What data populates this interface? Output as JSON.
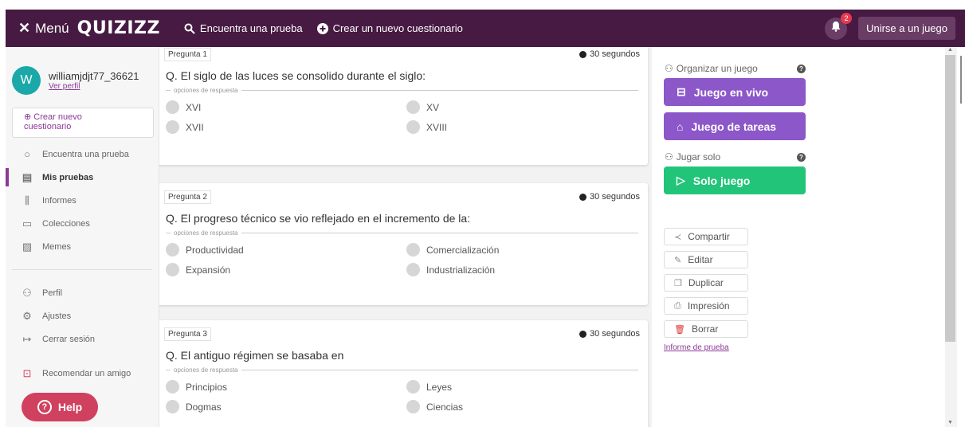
{
  "topbar": {
    "menu_label": "Menú",
    "logo_text": "QUIZIZZ",
    "search_label": "Encuentra una prueba",
    "create_label": "Crear un nuevo cuestionario",
    "notifications_count": "2",
    "join_label": "Unirse a un juego"
  },
  "sidebar": {
    "avatar_initial": "W",
    "username": "williamjdjt77_36621",
    "profile_link": "Ver perfil",
    "create_line1": "Crear nuevo",
    "create_line2": "cuestionario",
    "items": [
      {
        "label": "Encuentra una prueba",
        "icon": "search-icon"
      },
      {
        "label": "Mis pruebas",
        "icon": "document-icon"
      },
      {
        "label": "Informes",
        "icon": "bar-chart-icon"
      },
      {
        "label": "Colecciones",
        "icon": "folder-icon"
      },
      {
        "label": "Memes",
        "icon": "image-icon"
      }
    ],
    "items2": [
      {
        "label": "Perfil",
        "icon": "user-icon"
      },
      {
        "label": "Ajustes",
        "icon": "gear-icon"
      },
      {
        "label": "Cerrar sesión",
        "icon": "logout-icon"
      },
      {
        "label": "Recomendar un amigo",
        "icon": "gift-icon"
      }
    ],
    "help_label": "Help"
  },
  "questions": [
    {
      "tag": "Pregunta 1",
      "time": "30 segundos",
      "text": "Q. El siglo de las luces se consolido durante el siglo:",
      "options_label": "opciones de respuesta",
      "options": [
        "XVI",
        "XV",
        "XVII",
        "XVIII"
      ]
    },
    {
      "tag": "Pregunta 2",
      "time": "30 segundos",
      "text": "Q. El progreso técnico se vio reflejado en el incremento de la:",
      "options_label": "opciones de respuesta",
      "options": [
        "Productividad",
        "Comercialización",
        "Expansión",
        "Industrialización"
      ]
    },
    {
      "tag": "Pregunta 3",
      "time": "30 segundos",
      "text": "Q. El antiguo régimen se basaba en",
      "options_label": "opciones de respuesta",
      "options": [
        "Principios",
        "Leyes",
        "Dogmas",
        "Ciencias"
      ]
    }
  ],
  "right": {
    "organize_title": "Organizar un juego",
    "live_game": "Juego en vivo",
    "homework": "Juego de tareas",
    "solo_title": "Jugar solo",
    "solo_game": "Solo juego",
    "actions": [
      "Compartir",
      "Editar",
      "Duplicar",
      "Impresión",
      "Borrar"
    ],
    "report_link": "Informe de prueba"
  },
  "colors": {
    "topbar": "#461a42",
    "accent": "#8b3a96",
    "purple_button": "#8c57c9",
    "green_button": "#22c47a",
    "help": "#d0415f"
  }
}
